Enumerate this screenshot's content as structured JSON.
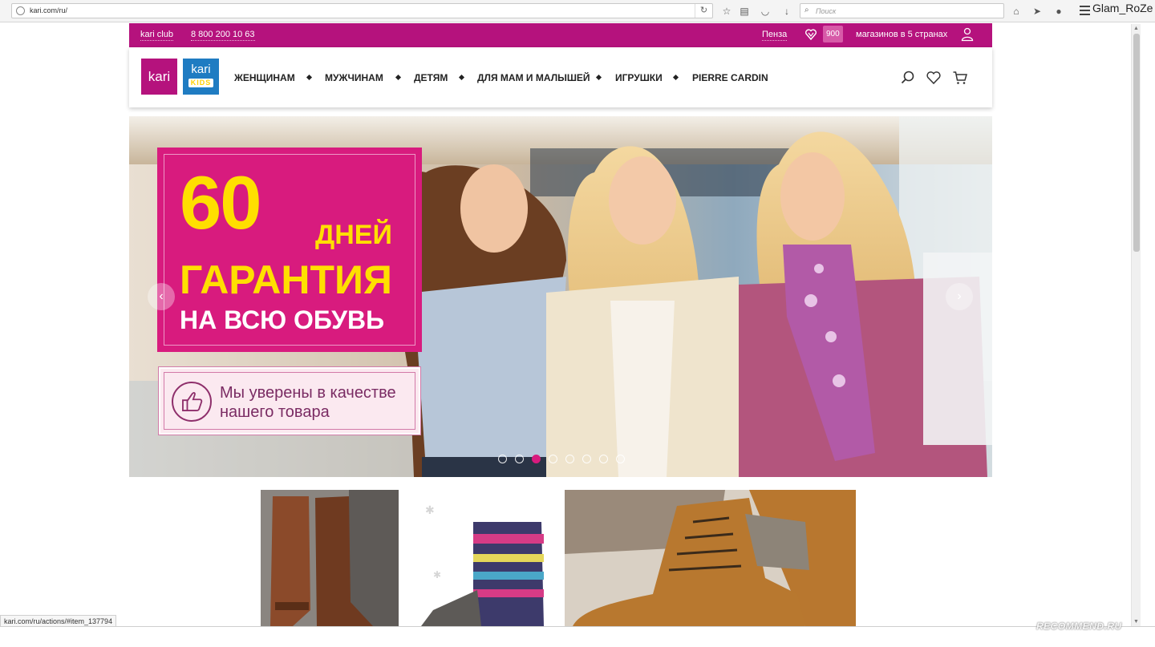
{
  "browser": {
    "url": "kari.com/ru/",
    "search_placeholder": "Поиск",
    "username": "Glam_RoZe",
    "status_url": "kari.com/ru/actions/#item_137794",
    "watermark": "RECOMMEND.RU"
  },
  "topbar": {
    "club": "kari club",
    "phone": "8 800 200 10 63",
    "city": "Пенза",
    "stores_count": "900",
    "stores_text": "магазинов в 5 странах"
  },
  "logos": {
    "kari": "kari",
    "kids_top": "kari",
    "kids_bottom": "KIDS"
  },
  "nav": {
    "items": [
      "ЖЕНЩИНАМ",
      "МУЖЧИНАМ",
      "ДЕТЯМ",
      "ДЛЯ МАМ И МАЛЫШЕЙ",
      "ИГРУШКИ",
      "PIERRE CARDIN"
    ]
  },
  "hero": {
    "number": "60",
    "days": "ДНЕЙ",
    "guarantee": "ГАРАНТИЯ",
    "all_shoes": "НА ВСЮ ОБУВЬ",
    "quality_line1": "Мы уверены в качестве",
    "quality_line2": "нашего товара",
    "slides_total": 8,
    "active_slide": 2
  },
  "colors": {
    "brand": "#b5127d",
    "promo": "#d81b7e",
    "promo_text": "#ffdf00",
    "kids": "#1f7cc2"
  }
}
